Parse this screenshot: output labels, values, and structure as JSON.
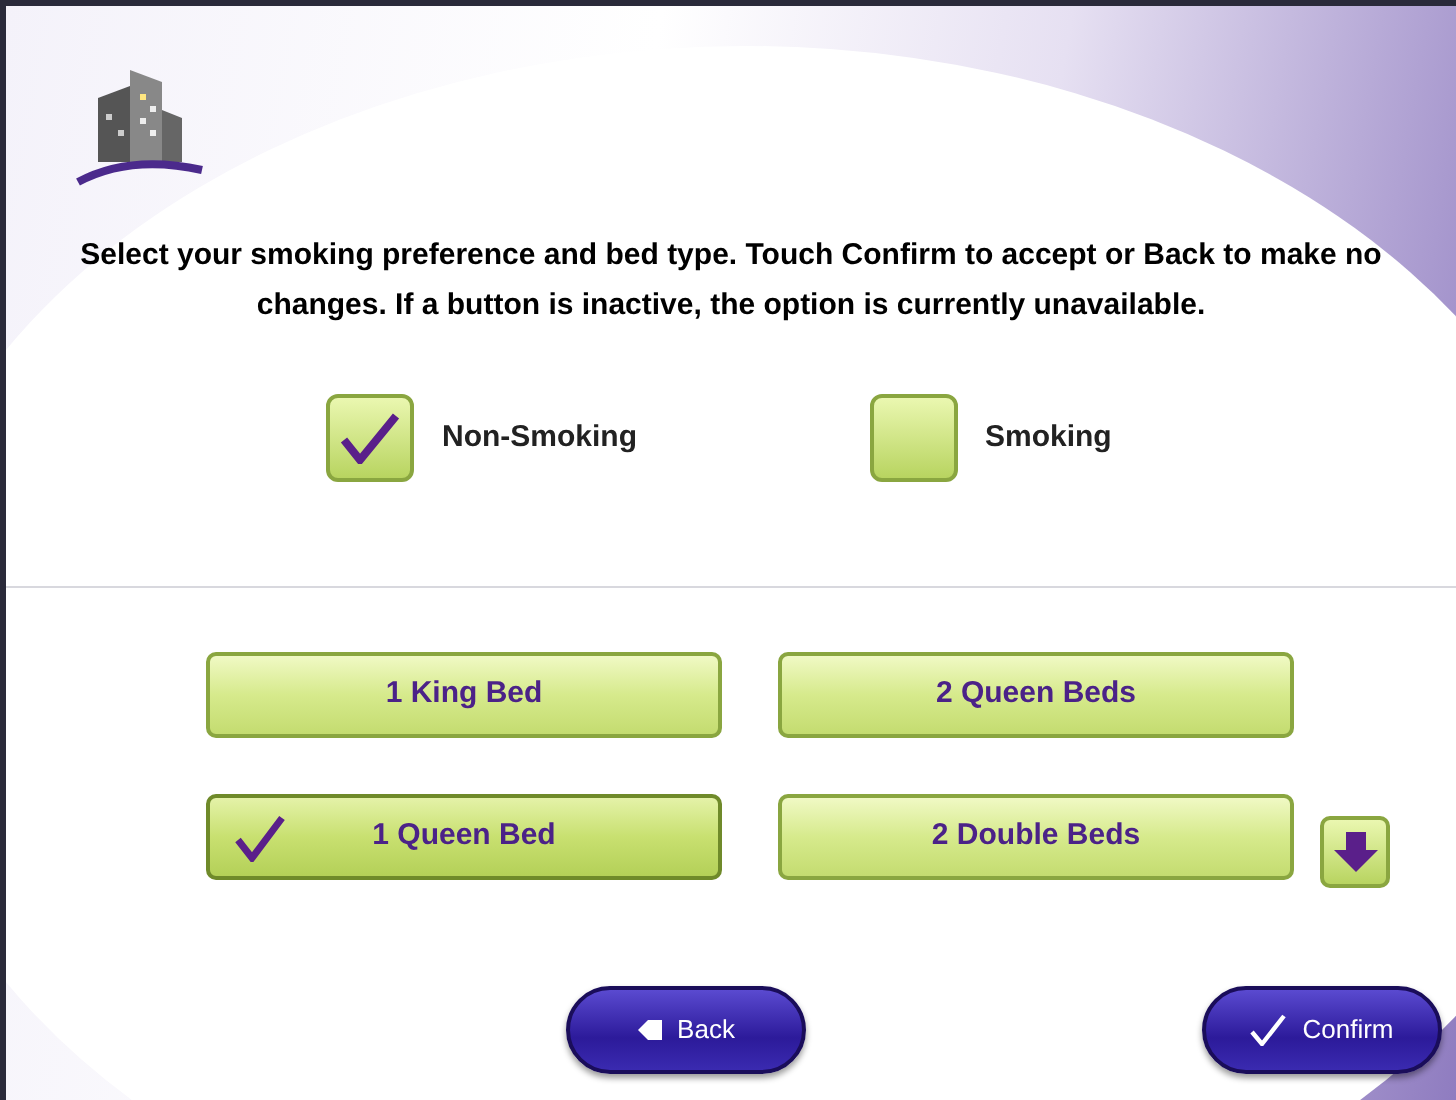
{
  "instructions": "Select your smoking preference and bed type. Touch Confirm to accept or Back to make no changes. If a button is inactive, the option is currently unavailable.",
  "smoking_options": [
    {
      "label": "Non-Smoking",
      "checked": true
    },
    {
      "label": "Smoking",
      "checked": false
    }
  ],
  "bed_types": [
    {
      "label": "1 King Bed",
      "selected": false
    },
    {
      "label": "2 Queen Beds",
      "selected": false
    },
    {
      "label": "1 Queen Bed",
      "selected": true
    },
    {
      "label": "2 Double Beds",
      "selected": false
    }
  ],
  "buttons": [
    {
      "kind": "back",
      "label": "Back"
    },
    {
      "kind": "confirm",
      "label": "Confirm"
    }
  ]
}
